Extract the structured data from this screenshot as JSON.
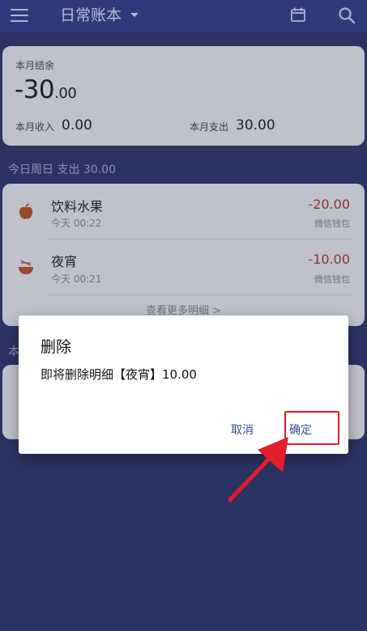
{
  "appbar": {
    "title": "日常账本"
  },
  "summary": {
    "label": "本月结余",
    "balance_main": "-30",
    "balance_decimal": ".00",
    "income_label": "本月收入",
    "income_value": "0.00",
    "expense_label": "本月支出",
    "expense_value": "30.00"
  },
  "today": {
    "header": "今日周日 支出 30.00",
    "items": [
      {
        "name": "饮料水果",
        "time": "今天 00:22",
        "amount": "-20.00",
        "account": "微信钱包",
        "icon": "apple-icon"
      },
      {
        "name": "夜宵",
        "time": "今天 00:21",
        "amount": "-10.00",
        "account": "微信钱包",
        "icon": "noodle-bowl-icon"
      }
    ],
    "more_link": "查看更多明细 >"
  },
  "partial_section_header": "本",
  "dialog": {
    "title": "删除",
    "message": "即将删除明细【夜宵】10.00",
    "cancel_label": "取消",
    "confirm_label": "确定"
  },
  "colors": {
    "background": "#2b3363",
    "appbar": "#2e3a7a",
    "expense_red": "#8e2f33",
    "dialog_button": "#3a4f8c",
    "annotation_red": "#e21e2a"
  }
}
